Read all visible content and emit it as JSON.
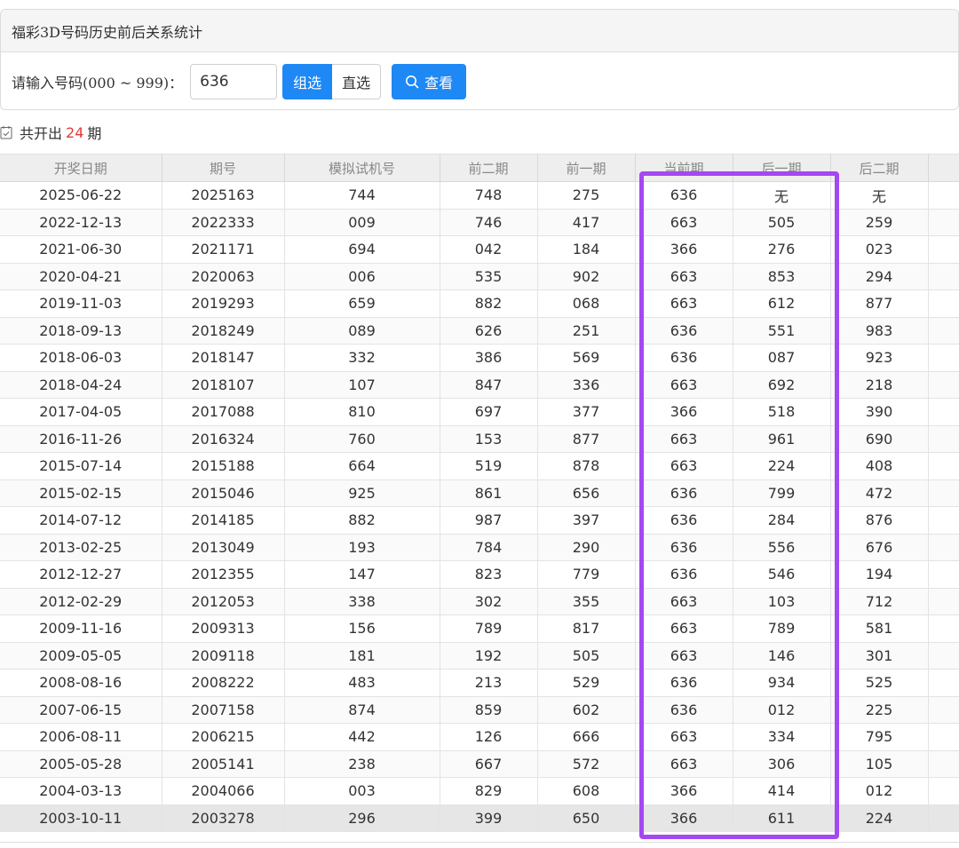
{
  "header": {
    "title": "福彩3D号码历史前后关系统计"
  },
  "query": {
    "label": "请输入号码(000 ~ 999)：",
    "value": "636",
    "group_btn": "组选",
    "direct_btn": "直选",
    "search_btn": "查看"
  },
  "summary": {
    "prefix": "共开出",
    "count": "24",
    "suffix": "期"
  },
  "table": {
    "headers": [
      "开奖日期",
      "期号",
      "模拟试机号",
      "前二期",
      "前一期",
      "当前期",
      "后一期",
      "后二期",
      ""
    ],
    "rows": [
      [
        "2025-06-22",
        "2025163",
        "744",
        "748",
        "275",
        "636",
        "无",
        "无"
      ],
      [
        "2022-12-13",
        "2022333",
        "009",
        "746",
        "417",
        "663",
        "505",
        "259"
      ],
      [
        "2021-06-30",
        "2021171",
        "694",
        "042",
        "184",
        "366",
        "276",
        "023"
      ],
      [
        "2020-04-21",
        "2020063",
        "006",
        "535",
        "902",
        "663",
        "853",
        "294"
      ],
      [
        "2019-11-03",
        "2019293",
        "659",
        "882",
        "068",
        "663",
        "612",
        "877"
      ],
      [
        "2018-09-13",
        "2018249",
        "089",
        "626",
        "251",
        "636",
        "551",
        "983"
      ],
      [
        "2018-06-03",
        "2018147",
        "332",
        "386",
        "569",
        "636",
        "087",
        "923"
      ],
      [
        "2018-04-24",
        "2018107",
        "107",
        "847",
        "336",
        "663",
        "692",
        "218"
      ],
      [
        "2017-04-05",
        "2017088",
        "810",
        "697",
        "377",
        "366",
        "518",
        "390"
      ],
      [
        "2016-11-26",
        "2016324",
        "760",
        "153",
        "877",
        "663",
        "961",
        "690"
      ],
      [
        "2015-07-14",
        "2015188",
        "664",
        "519",
        "878",
        "663",
        "224",
        "408"
      ],
      [
        "2015-02-15",
        "2015046",
        "925",
        "861",
        "656",
        "636",
        "799",
        "472"
      ],
      [
        "2014-07-12",
        "2014185",
        "882",
        "987",
        "397",
        "636",
        "284",
        "876"
      ],
      [
        "2013-02-25",
        "2013049",
        "193",
        "784",
        "290",
        "636",
        "556",
        "676"
      ],
      [
        "2012-12-27",
        "2012355",
        "147",
        "823",
        "779",
        "636",
        "546",
        "194"
      ],
      [
        "2012-02-29",
        "2012053",
        "338",
        "302",
        "355",
        "663",
        "103",
        "712"
      ],
      [
        "2009-11-16",
        "2009313",
        "156",
        "789",
        "817",
        "663",
        "789",
        "581"
      ],
      [
        "2009-05-05",
        "2009118",
        "181",
        "192",
        "505",
        "663",
        "146",
        "301"
      ],
      [
        "2008-08-16",
        "2008222",
        "483",
        "213",
        "529",
        "636",
        "934",
        "525"
      ],
      [
        "2007-06-15",
        "2007158",
        "874",
        "859",
        "602",
        "636",
        "012",
        "225"
      ],
      [
        "2006-08-11",
        "2006215",
        "442",
        "126",
        "666",
        "663",
        "334",
        "795"
      ],
      [
        "2005-05-28",
        "2005141",
        "238",
        "667",
        "572",
        "663",
        "306",
        "105"
      ],
      [
        "2004-03-13",
        "2004066",
        "003",
        "829",
        "608",
        "366",
        "414",
        "012"
      ],
      [
        "2003-10-11",
        "2003278",
        "296",
        "399",
        "650",
        "366",
        "611",
        "224"
      ]
    ]
  },
  "colors": {
    "accent": "#1e88f5",
    "count": "#e53935",
    "highlight": "#a448f2"
  }
}
